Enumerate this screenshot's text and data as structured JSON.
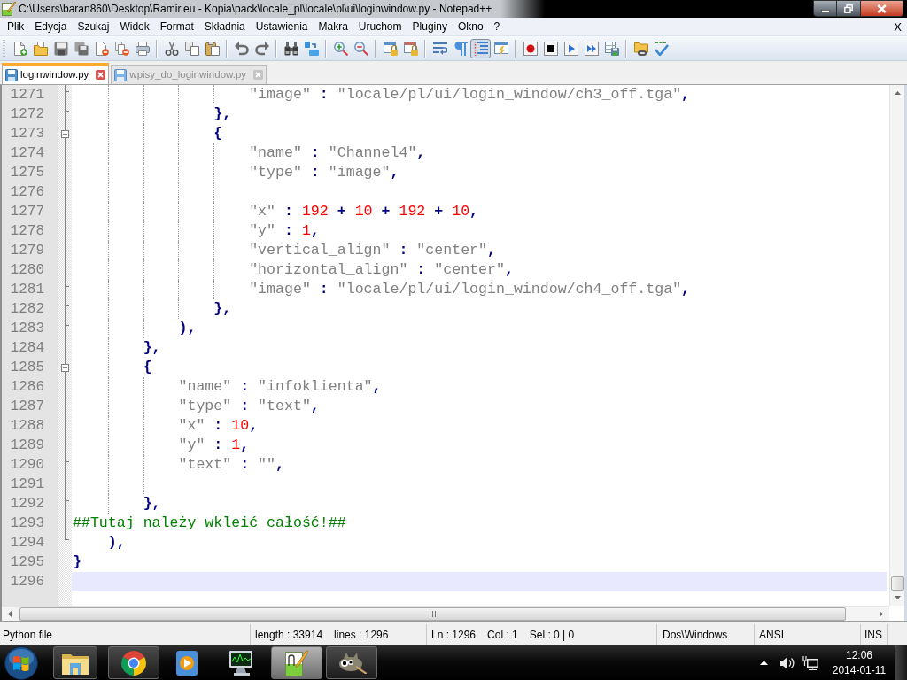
{
  "window": {
    "title": "C:\\Users\\baran860\\Desktop\\Ramir.eu - Kopia\\pack\\locale_pl\\locale\\pl\\ui\\loginwindow.py - Notepad++"
  },
  "menu": [
    "Plik",
    "Edycja",
    "Szukaj",
    "Widok",
    "Format",
    "Składnia",
    "Ustawienia",
    "Makra",
    "Uruchom",
    "Pluginy",
    "Okno",
    "?"
  ],
  "menu_close": "X",
  "toolbar": [
    {
      "buttons": [
        {
          "pressed": false
        },
        {
          "pressed": false
        },
        {
          "pressed": false
        },
        {
          "pressed": false
        },
        {
          "pressed": false
        },
        {
          "pressed": false
        },
        {
          "pressed": false
        }
      ]
    },
    {
      "buttons": [
        {
          "pressed": false
        },
        {
          "pressed": false
        },
        {
          "pressed": false
        }
      ]
    },
    {
      "buttons": [
        {
          "pressed": false
        },
        {
          "pressed": false
        }
      ]
    },
    {
      "buttons": [
        {
          "pressed": false
        },
        {
          "pressed": false
        }
      ]
    },
    {
      "buttons": [
        {
          "pressed": false
        },
        {
          "pressed": false
        }
      ]
    },
    {
      "buttons": [
        {
          "pressed": false
        },
        {
          "pressed": false
        }
      ]
    },
    {
      "buttons": [
        {
          "pressed": false
        },
        {
          "pressed": false
        },
        {
          "pressed": true
        },
        {
          "pressed": false
        }
      ]
    },
    {
      "buttons": [
        {
          "pressed": false
        },
        {
          "pressed": false
        },
        {
          "pressed": false
        },
        {
          "pressed": false
        },
        {
          "pressed": false
        }
      ]
    },
    {
      "buttons": [
        {
          "pressed": false
        },
        {
          "pressed": false
        }
      ]
    }
  ],
  "tabs": [
    {
      "label": "loginwindow.py",
      "selected": true
    },
    {
      "label": "wpisy_do_loginwindow.py",
      "selected": false
    }
  ],
  "editor": {
    "lines": [
      {
        "number": "1271",
        "fold": {
          "kind": "tick"
        },
        "current": false,
        "tokens": [
          {
            "kind": "string",
            "text": "                    \"image\""
          },
          {
            "kind": "operator",
            "text": " : "
          },
          {
            "kind": "string",
            "text": "\"locale/pl/ui/login_window/ch3_off.tga\""
          },
          {
            "kind": "operator",
            "text": ","
          }
        ]
      },
      {
        "number": "1272",
        "fold": {
          "kind": "tick"
        },
        "current": false,
        "tokens": [
          {
            "kind": "operator",
            "text": "                },"
          }
        ]
      },
      {
        "number": "1273",
        "fold": {
          "kind": "box"
        },
        "current": false,
        "tokens": [
          {
            "kind": "operator",
            "text": "                {"
          }
        ]
      },
      {
        "number": "1274",
        "fold": {
          "kind": "line"
        },
        "current": false,
        "tokens": [
          {
            "kind": "string",
            "text": "                    \"name\""
          },
          {
            "kind": "operator",
            "text": " : "
          },
          {
            "kind": "string",
            "text": "\"Channel4\""
          },
          {
            "kind": "operator",
            "text": ","
          }
        ]
      },
      {
        "number": "1275",
        "fold": {
          "kind": "line"
        },
        "current": false,
        "tokens": [
          {
            "kind": "string",
            "text": "                    \"type\""
          },
          {
            "kind": "operator",
            "text": " : "
          },
          {
            "kind": "string",
            "text": "\"image\""
          },
          {
            "kind": "operator",
            "text": ","
          }
        ]
      },
      {
        "number": "1276",
        "fold": {
          "kind": "line"
        },
        "current": false
      },
      {
        "number": "1277",
        "fold": {
          "kind": "line"
        },
        "current": false,
        "tokens": [
          {
            "kind": "string",
            "text": "                    \"x\""
          },
          {
            "kind": "operator",
            "text": " : "
          },
          {
            "kind": "number",
            "text": "192"
          },
          {
            "kind": "operator",
            "text": " + "
          },
          {
            "kind": "number",
            "text": "10"
          },
          {
            "kind": "operator",
            "text": " + "
          },
          {
            "kind": "number",
            "text": "192"
          },
          {
            "kind": "operator",
            "text": " + "
          },
          {
            "kind": "number",
            "text": "10"
          },
          {
            "kind": "operator",
            "text": ","
          }
        ]
      },
      {
        "number": "1278",
        "fold": {
          "kind": "line"
        },
        "current": false,
        "tokens": [
          {
            "kind": "string",
            "text": "                    \"y\""
          },
          {
            "kind": "operator",
            "text": " : "
          },
          {
            "kind": "number",
            "text": "1"
          },
          {
            "kind": "operator",
            "text": ","
          }
        ]
      },
      {
        "number": "1279",
        "fold": {
          "kind": "line"
        },
        "current": false,
        "tokens": [
          {
            "kind": "string",
            "text": "                    \"vertical_align\""
          },
          {
            "kind": "operator",
            "text": " : "
          },
          {
            "kind": "string",
            "text": "\"center\""
          },
          {
            "kind": "operator",
            "text": ","
          }
        ]
      },
      {
        "number": "1280",
        "fold": {
          "kind": "line"
        },
        "current": false,
        "tokens": [
          {
            "kind": "string",
            "text": "                    \"horizontal_align\""
          },
          {
            "kind": "operator",
            "text": " : "
          },
          {
            "kind": "string",
            "text": "\"center\""
          },
          {
            "kind": "operator",
            "text": ","
          }
        ]
      },
      {
        "number": "1281",
        "fold": {
          "kind": "tick"
        },
        "current": false,
        "tokens": [
          {
            "kind": "string",
            "text": "                    \"image\""
          },
          {
            "kind": "operator",
            "text": " : "
          },
          {
            "kind": "string",
            "text": "\"locale/pl/ui/login_window/ch4_off.tga\""
          },
          {
            "kind": "operator",
            "text": ","
          }
        ]
      },
      {
        "number": "1282",
        "fold": {
          "kind": "tick"
        },
        "current": false,
        "tokens": [
          {
            "kind": "operator",
            "text": "                },"
          }
        ]
      },
      {
        "number": "1283",
        "fold": {
          "kind": "tick"
        },
        "current": false,
        "tokens": [
          {
            "kind": "operator",
            "text": "            ),"
          }
        ]
      },
      {
        "number": "1284",
        "fold": {
          "kind": "line"
        },
        "current": false,
        "tokens": [
          {
            "kind": "operator",
            "text": "        },"
          }
        ]
      },
      {
        "number": "1285",
        "fold": {
          "kind": "box"
        },
        "current": false,
        "tokens": [
          {
            "kind": "operator",
            "text": "        {"
          }
        ]
      },
      {
        "number": "1286",
        "fold": {
          "kind": "line"
        },
        "current": false,
        "tokens": [
          {
            "kind": "string",
            "text": "            \"name\""
          },
          {
            "kind": "operator",
            "text": " : "
          },
          {
            "kind": "string",
            "text": "\"infoklienta\""
          },
          {
            "kind": "operator",
            "text": ","
          }
        ]
      },
      {
        "number": "1287",
        "fold": {
          "kind": "line"
        },
        "current": false,
        "tokens": [
          {
            "kind": "string",
            "text": "            \"type\""
          },
          {
            "kind": "operator",
            "text": " : "
          },
          {
            "kind": "string",
            "text": "\"text\""
          },
          {
            "kind": "operator",
            "text": ","
          }
        ]
      },
      {
        "number": "1288",
        "fold": {
          "kind": "line"
        },
        "current": false,
        "tokens": [
          {
            "kind": "string",
            "text": "            \"x\""
          },
          {
            "kind": "operator",
            "text": " : "
          },
          {
            "kind": "number",
            "text": "10"
          },
          {
            "kind": "operator",
            "text": ","
          }
        ]
      },
      {
        "number": "1289",
        "fold": {
          "kind": "line"
        },
        "current": false,
        "tokens": [
          {
            "kind": "string",
            "text": "            \"y\""
          },
          {
            "kind": "operator",
            "text": " : "
          },
          {
            "kind": "number",
            "text": "1"
          },
          {
            "kind": "operator",
            "text": ","
          }
        ]
      },
      {
        "number": "1290",
        "fold": {
          "kind": "tick"
        },
        "current": false,
        "tokens": [
          {
            "kind": "string",
            "text": "            \"text\""
          },
          {
            "kind": "operator",
            "text": " : "
          },
          {
            "kind": "string",
            "text": "\"\""
          },
          {
            "kind": "operator",
            "text": ","
          }
        ]
      },
      {
        "number": "1291",
        "fold": {
          "kind": "line"
        },
        "current": false
      },
      {
        "number": "1292",
        "fold": {
          "kind": "tick"
        },
        "current": false,
        "tokens": [
          {
            "kind": "operator",
            "text": "        },"
          }
        ]
      },
      {
        "number": "1293",
        "fold": {
          "kind": "line"
        },
        "current": false,
        "tokens": [
          {
            "kind": "comment",
            "text": "##Tutaj należy wkleić całość!##"
          }
        ]
      },
      {
        "number": "1294",
        "fold": {
          "kind": "end"
        },
        "current": false,
        "tokens": [
          {
            "kind": "operator",
            "text": "    ),"
          }
        ]
      },
      {
        "number": "1295",
        "current": false,
        "tokens": [
          {
            "kind": "operator",
            "text": "}"
          }
        ]
      },
      {
        "number": "1296",
        "current": true
      }
    ]
  },
  "status_bar": {
    "file_type": "Python file",
    "length": "length : 33914",
    "lines": "lines : 1296",
    "line": "Ln : 1296",
    "column": "Col : 1",
    "selection": "Sel : 0 | 0",
    "eol": "Dos\\Windows",
    "encoding": "ANSI",
    "insert_mode": "INS"
  },
  "taskbar": {
    "apps": [
      {
        "running": true,
        "selected": false
      },
      {
        "running": true,
        "selected": false
      },
      {
        "running": false,
        "selected": false
      },
      {
        "running": false,
        "selected": false
      },
      {
        "running": true,
        "selected": true
      },
      {
        "running": true,
        "selected": false
      }
    ],
    "clock": {
      "time": "12:06",
      "date": "2014-01-11"
    }
  }
}
